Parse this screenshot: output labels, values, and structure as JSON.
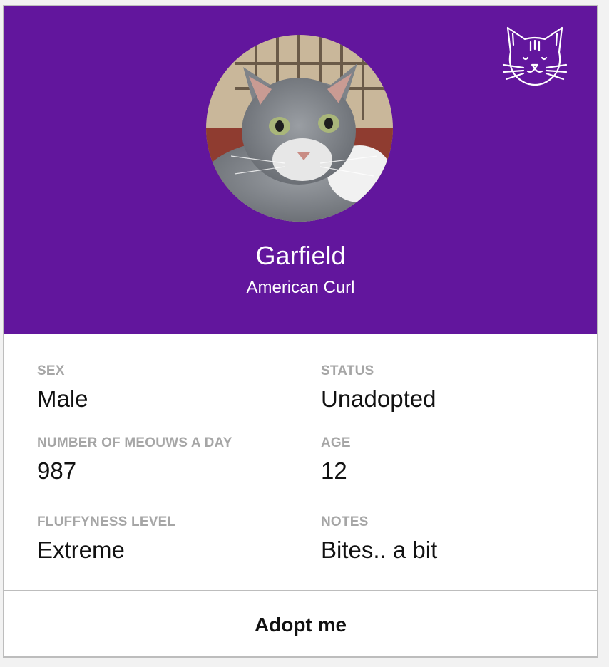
{
  "colors": {
    "header_bg": "#62169d",
    "label": "#a6a6a6",
    "value": "#111111",
    "border": "#bdbdbd"
  },
  "header": {
    "logo_icon": "cat-face-icon",
    "photo": "cat-photo",
    "name": "Garfield",
    "breed": "American Curl"
  },
  "details": {
    "sex": {
      "label": "SEX",
      "value": "Male"
    },
    "status": {
      "label": "STATUS",
      "value": "Unadopted"
    },
    "meows": {
      "label": "NUMBER OF MEOUWS A DAY",
      "value": "987"
    },
    "age": {
      "label": "AGE",
      "value": "12"
    },
    "fluffyness": {
      "label": "FLUFFYNESS LEVEL",
      "value": "Extreme"
    },
    "notes": {
      "label": "NOTES",
      "value": "Bites.. a bit"
    }
  },
  "actions": {
    "adopt_label": "Adopt me"
  }
}
